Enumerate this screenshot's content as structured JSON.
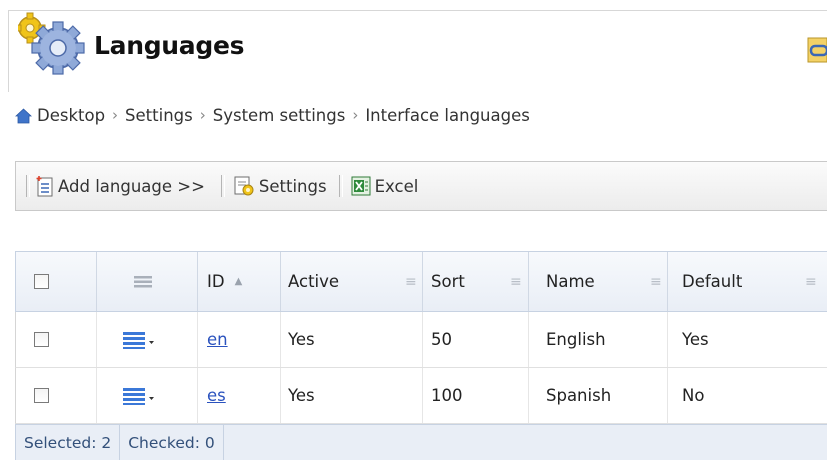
{
  "header": {
    "title": "Languages",
    "icon": "gears-icon",
    "link_icon": "link-icon"
  },
  "breadcrumb": {
    "icon": "home-icon",
    "items": [
      "Desktop",
      "Settings",
      "System settings",
      "Interface languages"
    ],
    "separator": "›"
  },
  "toolbar": {
    "add_language": "Add language >>",
    "settings": "Settings",
    "excel": "Excel"
  },
  "grid": {
    "columns": [
      "ID",
      "Active",
      "Sort",
      "Name",
      "Default"
    ],
    "rows": [
      {
        "id": "en",
        "active": "Yes",
        "sort": "50",
        "name": "English",
        "default": "Yes"
      },
      {
        "id": "es",
        "active": "Yes",
        "sort": "100",
        "name": "Spanish",
        "default": "No"
      }
    ],
    "footer": {
      "selected": "Selected: 2",
      "checked": "Checked: 0"
    }
  },
  "colors": {
    "link": "#2a52be",
    "header_bg": "#e9eef6",
    "border": "#c7d2e2"
  }
}
